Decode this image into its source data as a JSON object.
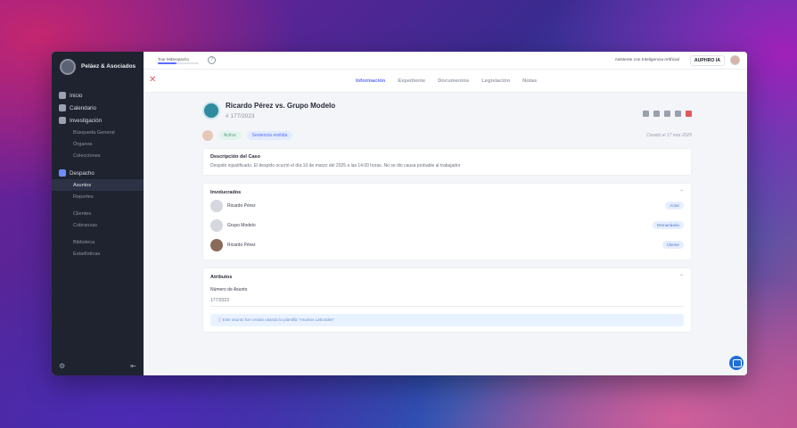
{
  "sidebar": {
    "brand": "Peláez & Asociados",
    "items": [
      {
        "label": "Inicio"
      },
      {
        "label": "Calendario"
      },
      {
        "label": "Investigación"
      },
      {
        "label": "Búsqueda General"
      },
      {
        "label": "Órganos"
      },
      {
        "label": "Colecciones"
      },
      {
        "label": "Despacho"
      },
      {
        "label": "Asuntos"
      },
      {
        "label": "Reportes"
      },
      {
        "label": "Clientes"
      },
      {
        "label": "Cobranzas"
      },
      {
        "label": "Biblioteca"
      },
      {
        "label": "Estadísticas"
      }
    ]
  },
  "topbar": {
    "tour_label": "Tour MiDespacho",
    "tour_progress": 0.45,
    "assistant": "Asistente con Inteligencia Artificial",
    "auphro": "AUPHRO IA"
  },
  "tabs": [
    "Información",
    "Expediente",
    "Documentos",
    "Legislación",
    "Notas"
  ],
  "case": {
    "title": "Ricardo Pérez vs. Grupo Modelo",
    "number": "# 177/2023",
    "status": "Activo",
    "stage": "Sentencia emitida",
    "created": "Creado el 17 mar 2025"
  },
  "description": {
    "title": "Descripción del Caso",
    "text": "Despido injustificado. El despido ocurrió el día 10 de marzo del 2025 a las 14:00 horas. No se dio causa probable al trabajador"
  },
  "involved": {
    "title": "Involucrados",
    "people": [
      {
        "name": "Ricardo Pérez",
        "role": "Actor"
      },
      {
        "name": "Grupo Modelo",
        "role": "Demandado"
      },
      {
        "name": "Ricardo Pérez",
        "role": "Cliente"
      }
    ]
  },
  "attributes": {
    "title": "Atributos",
    "field_label": "Número de Asunto",
    "field_value": "177/2023",
    "info": "Este asunto fue creado usando la plantilla \"Asuntos Laborales\""
  }
}
